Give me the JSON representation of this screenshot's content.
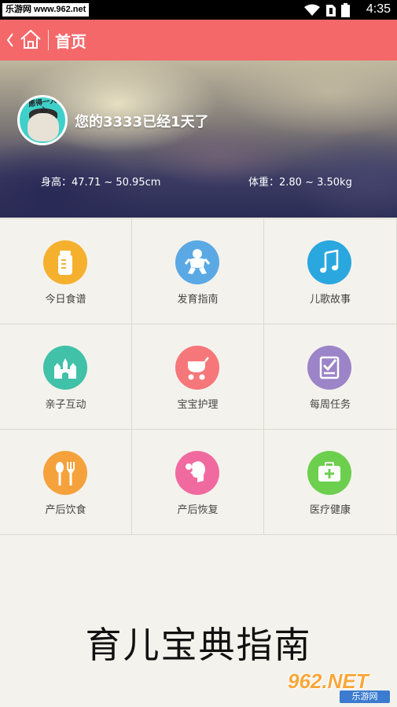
{
  "status_bar": {
    "watermark": "乐游网 www.962.net",
    "time": "4:35",
    "icons": [
      "wifi-icon",
      "no-sim-icon",
      "battery-icon"
    ]
  },
  "title_bar": {
    "title": "首页",
    "back_icon": "chevron-left-icon",
    "home_icon": "home-icon",
    "color": "#f4686a"
  },
  "profile": {
    "baby_status": "您的3333已经1天了",
    "height_label": "身高：47.71 ~ 50.95cm",
    "weight_label": "体重：2.80 ~ 3.50kg",
    "avatar_text": "愿得一人心"
  },
  "grid": {
    "items": [
      {
        "label": "今日食谱",
        "icon": "baby-bottle-icon",
        "color": "#f5b02e"
      },
      {
        "label": "发育指南",
        "icon": "baby-icon",
        "color": "#5aa9e4"
      },
      {
        "label": "儿歌故事",
        "icon": "music-note-icon",
        "color": "#2aa7df"
      },
      {
        "label": "亲子互动",
        "icon": "castle-icon",
        "color": "#40c1a8"
      },
      {
        "label": "宝宝护理",
        "icon": "stroller-icon",
        "color": "#f6777a"
      },
      {
        "label": "每周任务",
        "icon": "checklist-icon",
        "color": "#9b84c7"
      },
      {
        "label": "产后饮食",
        "icon": "fork-spoon-icon",
        "color": "#f5a23c"
      },
      {
        "label": "产后恢复",
        "icon": "woman-profile-icon",
        "color": "#f06aa0"
      },
      {
        "label": "医疗健康",
        "icon": "medical-kit-icon",
        "color": "#6ccf4e"
      }
    ]
  },
  "footer": {
    "big_title": "育儿宝典指南",
    "logo_main": "962.NET",
    "logo_sub": "乐游网"
  }
}
